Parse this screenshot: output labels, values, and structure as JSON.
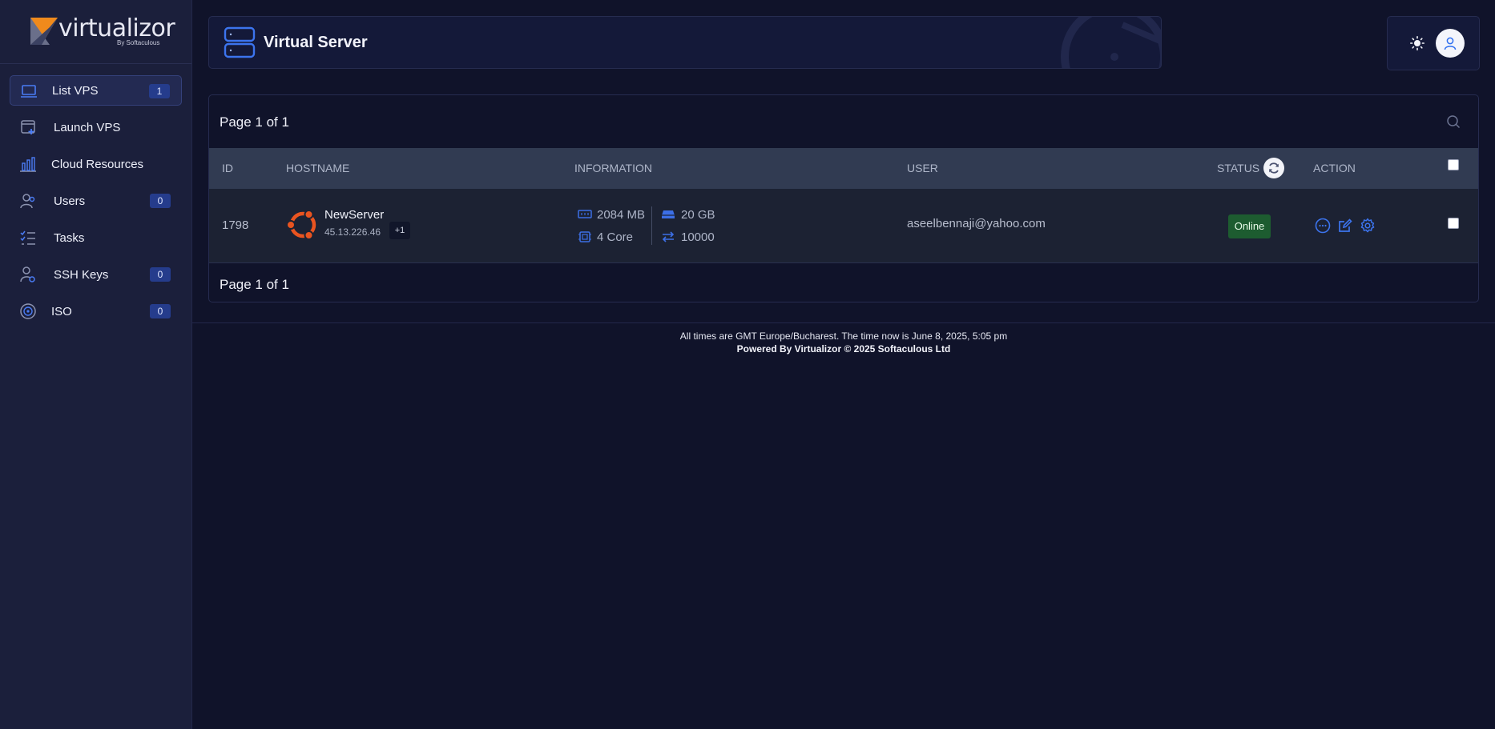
{
  "brand": {
    "name": "virtualizor",
    "by": "By Softaculous"
  },
  "sidebar": {
    "items": [
      {
        "label": "List VPS",
        "badge": "1",
        "icon": "laptop-icon"
      },
      {
        "label": "Launch VPS",
        "badge": "",
        "icon": "launch-window-icon"
      },
      {
        "label": "Cloud Resources",
        "badge": "",
        "icon": "bar-chart-icon"
      },
      {
        "label": "Users",
        "badge": "0",
        "icon": "users-icon"
      },
      {
        "label": "Tasks",
        "badge": "",
        "icon": "task-list-icon"
      },
      {
        "label": "SSH Keys",
        "badge": "0",
        "icon": "user-key-icon"
      },
      {
        "label": "ISO",
        "badge": "0",
        "icon": "disc-icon"
      }
    ]
  },
  "header": {
    "title": "Virtual Server"
  },
  "table": {
    "page_info_top": "Page 1 of 1",
    "page_info_bottom": "Page 1 of 1",
    "columns": {
      "id": "ID",
      "hostname": "HOSTNAME",
      "information": "INFORMATION",
      "user": "USER",
      "status": "STATUS",
      "action": "ACTION"
    },
    "rows": [
      {
        "id": "1798",
        "hostname": "NewServer",
        "ip": "45.13.226.46",
        "ip_more": "+1",
        "os": "ubuntu-icon",
        "ram": "2084 MB",
        "cpu": "4 Core",
        "disk": "20 GB",
        "bandwidth": "10000",
        "user": "aseelbennaji@yahoo.com",
        "status": "Online"
      }
    ]
  },
  "footer": {
    "time_line": "All times are GMT Europe/Bucharest. The time now is June 8, 2025, 5:05 pm",
    "powered": "Powered By Virtualizor © 2025 Softaculous Ltd"
  },
  "colors": {
    "accent": "#2f6ff0",
    "online": "#1d5c30",
    "ubuntu": "#e95420"
  }
}
